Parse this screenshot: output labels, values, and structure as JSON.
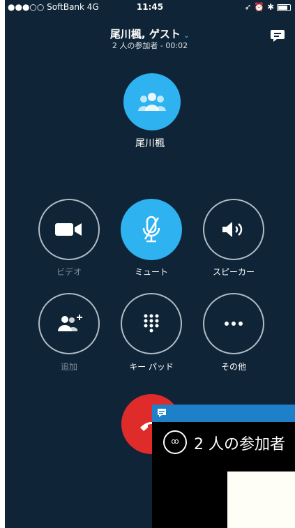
{
  "status_bar": {
    "carrier": "●●●○○ SoftBank  4G",
    "time": "11:45",
    "indicators": "➶ ⏰ ✱"
  },
  "header": {
    "title": "尾川楓, ゲスト",
    "subtitle": "2 人の参加者 - 00:02",
    "chat_icon": "chat-bubble-icon"
  },
  "contact": {
    "name": "尾川楓",
    "avatar_icon": "group-icon"
  },
  "controls": [
    {
      "label": "ビデオ",
      "icon": "video-camera-icon",
      "active": false,
      "disabled": true
    },
    {
      "label": "ミュート",
      "icon": "mic-off-icon",
      "active": true,
      "disabled": false
    },
    {
      "label": "スピーカー",
      "icon": "speaker-icon",
      "active": false,
      "disabled": false
    },
    {
      "label": "追加",
      "icon": "add-person-icon",
      "active": false,
      "disabled": true
    },
    {
      "label": "キー パッド",
      "icon": "keypad-icon",
      "active": false,
      "disabled": false
    },
    {
      "label": "その他",
      "icon": "more-icon",
      "active": false,
      "disabled": false
    }
  ],
  "hangup": {
    "icon": "phone-hangup-icon"
  },
  "popup": {
    "participants_text": "2 人の参加者",
    "icon_glyph": "ꝏ"
  },
  "colors": {
    "background": "#0f2436",
    "accent": "#2eb2f0",
    "hangup": "#e02b2b",
    "popup_bar": "#1e80c9"
  }
}
